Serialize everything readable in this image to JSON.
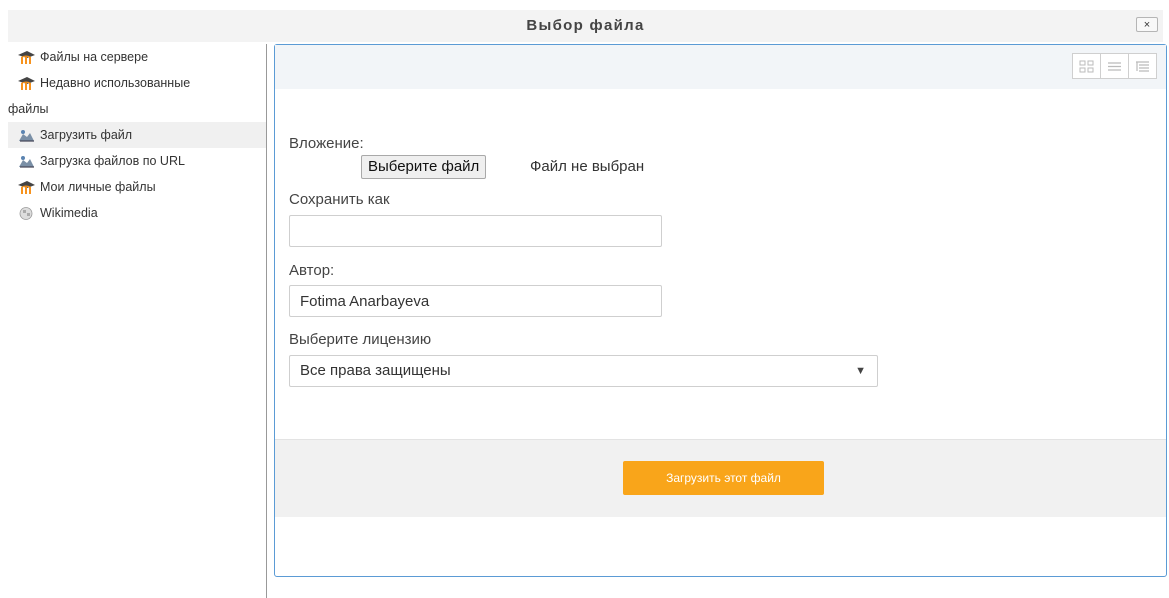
{
  "dialog": {
    "title": "Выбор файла",
    "close_label": "×"
  },
  "sidebar": {
    "items": [
      {
        "label": "Файлы на сервере",
        "icon": "moodle-icon"
      },
      {
        "label_line1": "Недавно использованные",
        "label_line2": "файлы",
        "icon": "moodle-icon"
      },
      {
        "label": "Загрузить файл",
        "icon": "upload-icon",
        "active": true
      },
      {
        "label": "Загрузка файлов по URL",
        "icon": "url-download-icon"
      },
      {
        "label": "Мои личные файлы",
        "icon": "moodle-icon"
      },
      {
        "label": "Wikimedia",
        "icon": "wikimedia-globe-icon"
      }
    ]
  },
  "view_buttons": [
    "icons-view",
    "list-view",
    "tree-view"
  ],
  "form": {
    "attachment_label": "Вложение:",
    "choose_file_button": "Выберите файл",
    "file_status": "Файл не выбран",
    "save_as_label": "Сохранить как",
    "save_as_value": "",
    "author_label": "Автор:",
    "author_value": "Fotima Anarbayeva",
    "license_label": "Выберите лицензию",
    "license_selected": "Все права защищены"
  },
  "footer": {
    "upload_button": "Загрузить этот файл"
  },
  "colors": {
    "accent_orange": "#f9a51a",
    "panel_border": "#5b9bd5",
    "moodle_orange": "#f7931e"
  }
}
